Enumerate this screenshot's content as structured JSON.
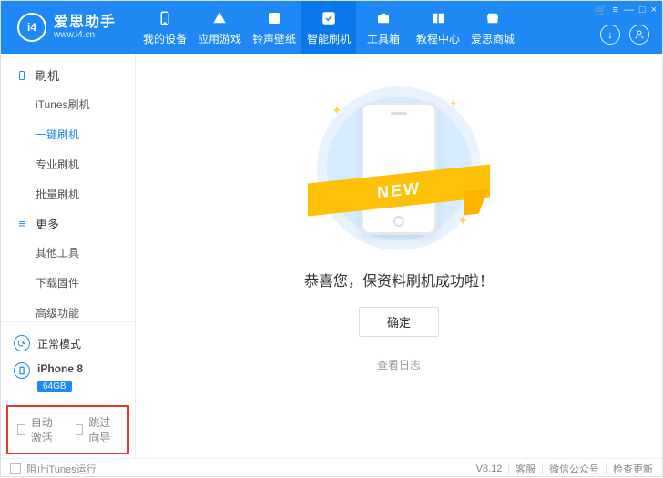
{
  "header": {
    "logo_initials": "i4",
    "title": "爱思助手",
    "url": "www.i4.cn",
    "nav": [
      {
        "label": "我的设备"
      },
      {
        "label": "应用游戏"
      },
      {
        "label": "铃声壁纸"
      },
      {
        "label": "智能刷机"
      },
      {
        "label": "工具箱"
      },
      {
        "label": "教程中心"
      },
      {
        "label": "爱思商城"
      }
    ],
    "sys": {
      "cart": "🛒",
      "menu": "≡",
      "min": "—",
      "max": "□",
      "close": "×"
    }
  },
  "sidebar": {
    "section1": {
      "title": "刷机",
      "items": [
        "iTunes刷机",
        "一键刷机",
        "专业刷机",
        "批量刷机"
      ],
      "active_index": 1
    },
    "section2": {
      "title": "更多",
      "items": [
        "其他工具",
        "下载固件",
        "高级功能"
      ]
    },
    "mode": "正常模式",
    "device": {
      "name": "iPhone 8",
      "storage": "64GB"
    },
    "option1": "自动激活",
    "option2": "跳过向导"
  },
  "main": {
    "ribbon": "NEW",
    "result": "恭喜您，保资料刷机成功啦！",
    "ok": "确定",
    "log": "查看日志"
  },
  "footer": {
    "block_itunes": "阻止iTunes运行",
    "version": "V8.12",
    "link1": "客服",
    "link2": "微信公众号",
    "link3": "检查更新"
  }
}
